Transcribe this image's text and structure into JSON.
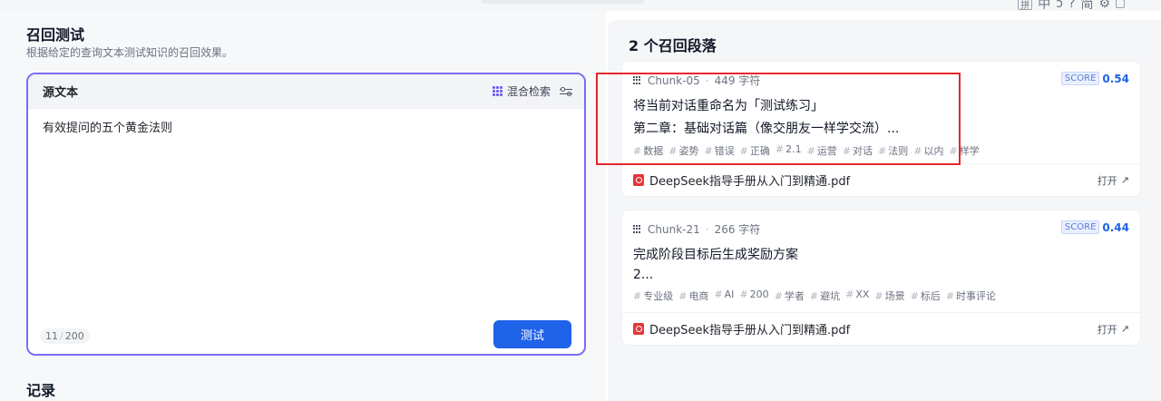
{
  "ime": {
    "items": [
      "拼",
      "中",
      "ɔ",
      "?",
      "简",
      "⚙"
    ]
  },
  "left": {
    "title": "召回测试",
    "description": "根据给定的查询文本测试知识的召回效果。",
    "query": {
      "label": "源文本",
      "mode_label": "混合检索",
      "text": "有效提问的五个黄金法则",
      "count": "11",
      "max": "200",
      "button": "测试"
    },
    "records_title": "记录"
  },
  "right": {
    "title": "2 个召回段落",
    "chunks": [
      {
        "id": "Chunk-05",
        "chars": "449 字符",
        "score_label": "SCORE",
        "score": "0.54",
        "line1": "将当前对话重命名为「测试练习」",
        "line2": "第二章：基础对话篇（像交朋友一样学交流）...",
        "keywords": [
          "数据",
          "姿势",
          "错误",
          "正确",
          "2.1",
          "运营",
          "对话",
          "法则",
          "以内",
          "样学"
        ],
        "file": "DeepSeek指导手册从入门到精通.pdf",
        "open": "打开"
      },
      {
        "id": "Chunk-21",
        "chars": "266 字符",
        "score_label": "SCORE",
        "score": "0.44",
        "line1": "完成阶段目标后生成奖励方案",
        "line2": "2...",
        "keywords": [
          "专业级",
          "电商",
          "AI",
          "200",
          "学者",
          "避坑",
          "XX",
          "场景",
          "标后",
          "时事评论"
        ],
        "file": "DeepSeek指导手册从入门到精通.pdf",
        "open": "打开"
      }
    ]
  },
  "colors": {
    "accent": "#1f63e8",
    "focus_border": "#7b6cf6",
    "annotation": "#e6262b",
    "pdf": "#e5353a"
  }
}
